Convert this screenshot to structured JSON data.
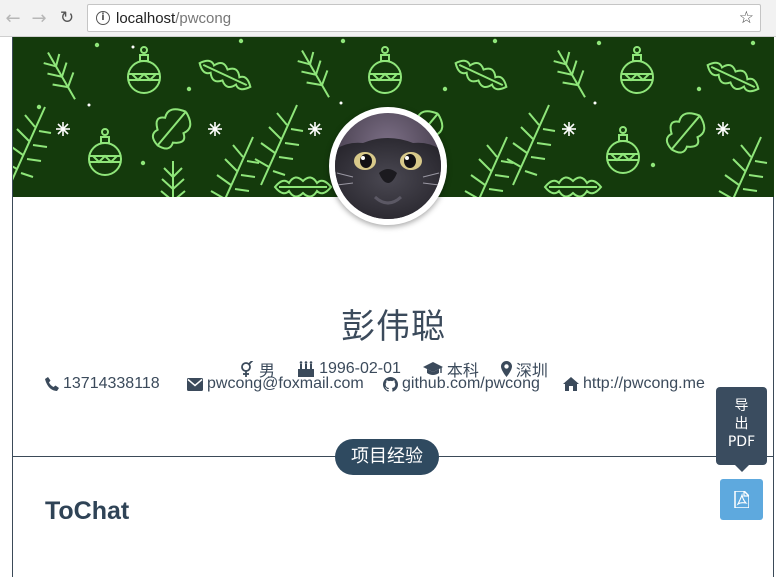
{
  "browser": {
    "url_host": "localhost",
    "url_path": "/pwcong",
    "icons": [
      "back-icon",
      "forward-icon",
      "reload-icon",
      "info-icon",
      "star-icon"
    ]
  },
  "profile": {
    "name": "彭伟聪",
    "gender": "男",
    "birthday": "1996-02-01",
    "education": "本科",
    "city": "深圳",
    "phone": "13714338118",
    "email": "pwcong@foxmail.com",
    "github": "github.com/pwcong",
    "website": "http://pwcong.me"
  },
  "section": {
    "label": "项目经验"
  },
  "project": {
    "title": "ToChat"
  },
  "export": {
    "tooltip_line1": "导",
    "tooltip_line2": "出",
    "tooltip_line3": "PDF"
  },
  "colors": {
    "banner_bg": "#143a0c",
    "pattern": "#8fe67a",
    "text_primary": "#3b4a5b",
    "pill_bg": "#2f4a60",
    "pdf_button": "#5ea9de"
  }
}
